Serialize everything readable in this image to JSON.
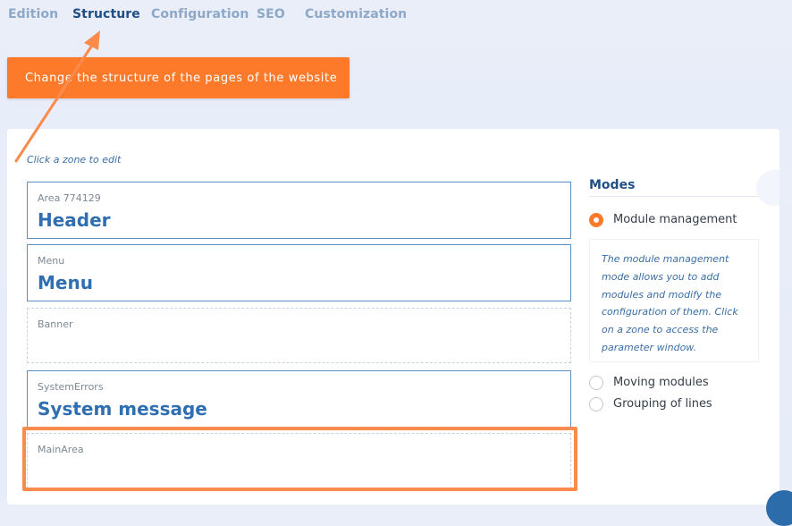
{
  "tabs": [
    {
      "label": "Edition",
      "active": false
    },
    {
      "label": "Structure",
      "active": true
    },
    {
      "label": "Configuration",
      "active": false
    },
    {
      "label": "SEO",
      "active": false
    },
    {
      "label": "Customization",
      "active": false
    }
  ],
  "tooltip": {
    "text": "Change the structure of the pages of the website"
  },
  "editor": {
    "hint": "Click a zone to edit",
    "zones": [
      {
        "label": "Area 774129",
        "title": "Header"
      },
      {
        "label": "Menu",
        "title": "Menu"
      },
      {
        "label": "Banner",
        "title": ""
      },
      {
        "label": "SystemErrors",
        "title": "System message"
      },
      {
        "label": "MainArea",
        "title": ""
      }
    ]
  },
  "modes": {
    "title": "Modes",
    "options": [
      {
        "label": "Module management",
        "selected": true
      },
      {
        "label": "Moving modules",
        "selected": false
      },
      {
        "label": "Grouping of lines",
        "selected": false
      }
    ],
    "description": "The module management mode allows you to add modules and modify the configuration of them. Click on a zone to access the parameter window."
  },
  "colors": {
    "accent": "#fd7a2a",
    "primary": "#2f6eb0",
    "tab_active": "#1f4e86",
    "tab_inactive": "#8ea8c8"
  }
}
